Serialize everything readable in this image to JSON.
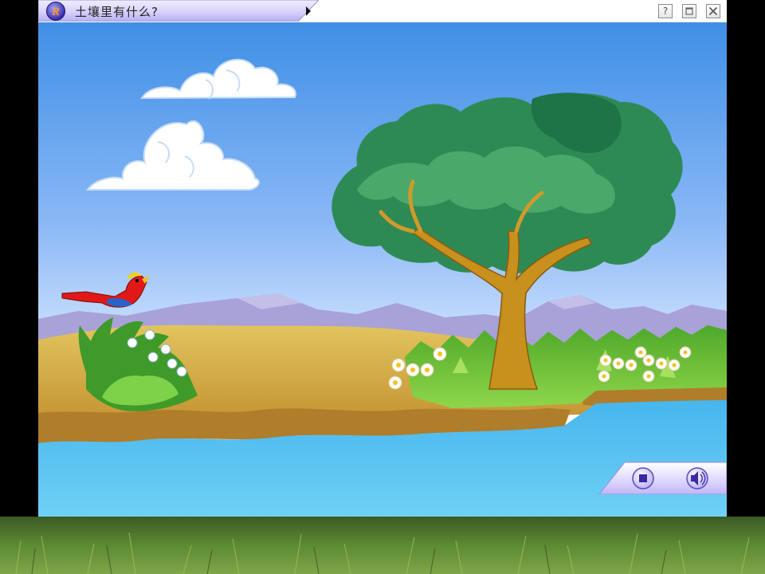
{
  "window": {
    "title": "土壤里有什么?"
  },
  "titlebar": {
    "logo_icon": "r-logo-icon",
    "menu_arrow_icon": "play-arrow-icon",
    "help_label": "?",
    "help_icon": "help-icon",
    "restore_icon": "restore-icon",
    "close_icon": "close-icon"
  },
  "player_controls": {
    "stop_icon": "stop-icon",
    "sound_icon": "speaker-icon"
  },
  "colors": {
    "sky_top": "#3f8fe6",
    "sky_bottom": "#cfe2ff",
    "water": "#5cc4f0",
    "sand": "#d9b64a",
    "grass": "#6cc13a",
    "tree_leaves": "#2e8a55",
    "tree_trunk": "#c8901c",
    "bird": "#e01818",
    "accent_purple": "#9a8ce8"
  }
}
